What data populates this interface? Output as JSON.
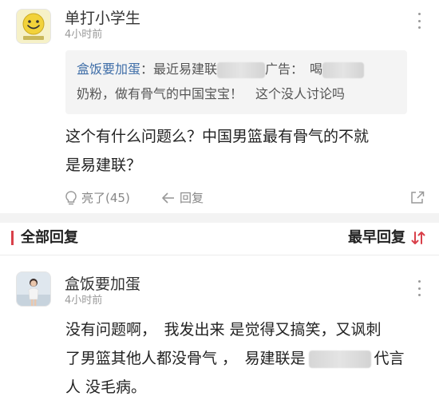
{
  "comment1": {
    "username": "单打小学生",
    "time": "4小时前",
    "avatar_icon": "smiley-face-avatar",
    "quote": {
      "author": "盒饭要加蛋",
      "text_part1": "最近易建联",
      "text_part2": "广告：　喝",
      "text_part3": "奶粉，做有骨气的中国宝宝！　这个没人讨论吗"
    },
    "body_line1": "这个有什么问题么？中国男篮最有骨气的不就",
    "body_line2": "是易建联？",
    "like_label": "亮了(45)",
    "reply_label": "回复"
  },
  "section": {
    "title": "全部回复",
    "sort_label": "最早回复"
  },
  "comment2": {
    "username": "盒饭要加蛋",
    "time": "4小时前",
    "body_line1": "没有问题啊，　我发出来 是觉得又搞笑，又讽刺",
    "body_line2a": "了男篮其他人都没骨气 ，　易建联是",
    "body_line2b": "代言",
    "body_line3": "人 没毛病。"
  },
  "colors": {
    "accent_red": "#d9404a",
    "link_blue": "#3f6ea8",
    "divider_gray": "#f3f3f3"
  }
}
